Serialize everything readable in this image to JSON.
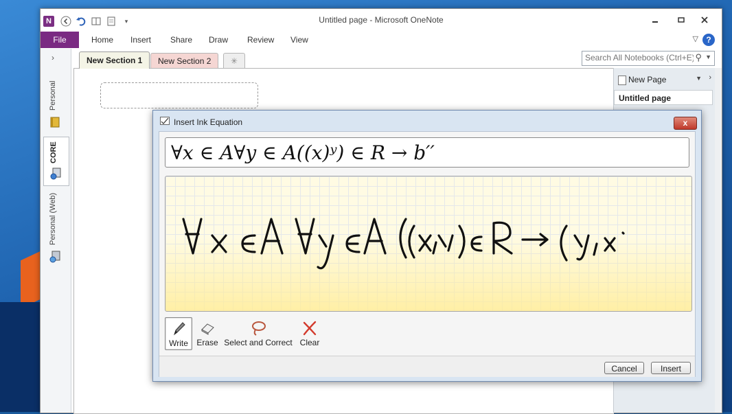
{
  "window": {
    "title": "Untitled page - Microsoft OneNote",
    "app_logo": "N"
  },
  "ribbon": {
    "file": "File",
    "tabs": [
      "Home",
      "Insert",
      "Share",
      "Draw",
      "Review",
      "View"
    ]
  },
  "notebooks": [
    {
      "label": "Personal",
      "icon": "notebook-yellow-icon"
    },
    {
      "label": "CORE",
      "icon": "notebook-network-icon",
      "active": true
    },
    {
      "label": "Personal (Web)",
      "icon": "notebook-web-icon"
    }
  ],
  "sections": {
    "tabs": [
      {
        "label": "New Section 1",
        "active": true,
        "color": "#f4f4e6"
      },
      {
        "label": "New Section 2",
        "active": false,
        "color": "#f5d6d3"
      }
    ],
    "new_section_icon": "new-section-tab-icon"
  },
  "search": {
    "placeholder": "Search All Notebooks (Ctrl+E)"
  },
  "pages": {
    "new_page_label": "New Page",
    "items": [
      "Untitled page"
    ]
  },
  "dialog": {
    "title": "Insert Ink Equation",
    "close_label": "x",
    "preview_text": "∀x ∈ A∀y ∈ A((x)ʸ) ∈ R → b′′",
    "tools": [
      {
        "label": "Write",
        "icon": "pen-icon",
        "active": true
      },
      {
        "label": "Erase",
        "icon": "eraser-icon",
        "active": false
      },
      {
        "label": "Select and Correct",
        "icon": "lasso-icon",
        "active": false
      },
      {
        "label": "Clear",
        "icon": "clear-x-icon",
        "active": false
      }
    ],
    "cancel_label": "Cancel",
    "insert_label": "Insert"
  }
}
